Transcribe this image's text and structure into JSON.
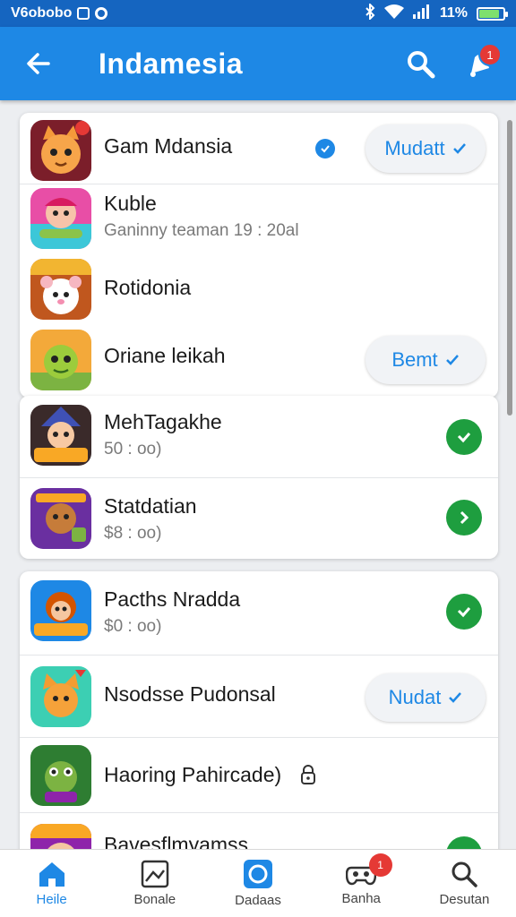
{
  "status_bar": {
    "left_text": "V6obobo",
    "right_text": "11%",
    "battery_level": 0.8
  },
  "app_bar": {
    "title": "Indamesia",
    "back_icon": "arrow-left-icon",
    "search_icon": "search-icon",
    "notify_icon": "notification-icon",
    "notify_badge": "1"
  },
  "cards": [
    {
      "rows": [
        {
          "name": "Gam Mdansia",
          "subtitle": "",
          "icon": "orange-cat-icon",
          "verified": true,
          "action": {
            "type": "pill",
            "label": "Mudatt"
          }
        },
        {
          "name": "Kuble",
          "subtitle": "Ganinny teaman 19 : 20al",
          "icon": "pink-doll-icon",
          "action": null
        },
        {
          "name": "Rotidonia",
          "subtitle": "",
          "icon": "hamster-icon",
          "action": null
        },
        {
          "name": "Oriane leikah",
          "subtitle": "",
          "icon": "green-monster-icon",
          "action": {
            "type": "pill",
            "label": "Bemt"
          }
        }
      ]
    },
    {
      "rows": [
        {
          "name": "MehTagakhe",
          "subtitle": "50 : oo)",
          "icon": "witch-icon",
          "action": {
            "type": "check"
          }
        },
        {
          "name": "Statdatian",
          "subtitle": "$8 : oo)",
          "icon": "monkey-warrior-icon",
          "action": {
            "type": "chevron"
          }
        }
      ]
    },
    {
      "rows": [
        {
          "name": "Pacths Nradda",
          "subtitle": "$0 : oo)",
          "icon": "monkey-king-icon",
          "action": {
            "type": "check"
          }
        },
        {
          "name": "Nsodsse Pudonsal",
          "subtitle": "",
          "icon": "orange-fox-icon",
          "action": {
            "type": "pill",
            "label": "Nudat"
          }
        },
        {
          "name": "Haoring Pahircade)",
          "subtitle": "",
          "icon": "green-frog-icon",
          "lock": true,
          "action": null
        },
        {
          "name": "Bavesflmyamss",
          "subtitle": "",
          "icon": "cartoon-dog-icon",
          "action": {
            "type": "check"
          }
        }
      ]
    }
  ],
  "bottom_nav": [
    {
      "label": "Heile",
      "icon": "home-icon",
      "active": true
    },
    {
      "label": "Bonale",
      "icon": "image-icon",
      "active": false
    },
    {
      "label": "Dadaas",
      "icon": "camera-icon",
      "active": false
    },
    {
      "label": "Banha",
      "icon": "gamepad-icon",
      "active": false,
      "badge": "1"
    },
    {
      "label": "Desutan",
      "icon": "search-icon",
      "active": false
    }
  ],
  "colors": {
    "app_bar": "#1e88e5",
    "status_bar": "#1565c0",
    "accent": "#1e88e5",
    "success": "#1e9e3f",
    "badge": "#e53935"
  }
}
